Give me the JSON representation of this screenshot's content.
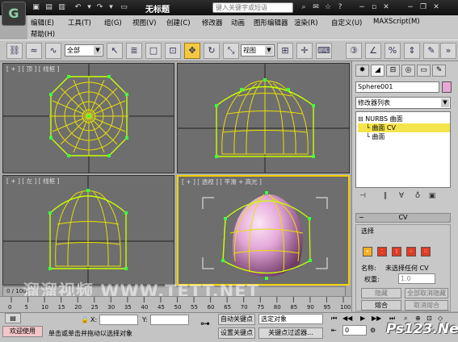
{
  "app": {
    "window_title": "无标题",
    "search_placeholder": "键入关键字或短语",
    "logo_glyph": "G"
  },
  "menu": {
    "items": [
      "编辑(E)",
      "工具(T)",
      "组(G)",
      "视图(V)",
      "创建(C)",
      "修改器",
      "动画",
      "图形编辑器",
      "渲染(R)",
      "自定义(U)",
      "MAXScript(M)",
      "帮助(H)"
    ]
  },
  "toolbar": {
    "filter_value": "全部",
    "coord_value": "视图",
    "active_tool": "select-and-move"
  },
  "viewports": {
    "top": "[ + ] [ 顶 ] [ 线框 ]",
    "left": "[ + ] [ 左 ] [ 线框 ]",
    "persp": "[ + ] [ 透视 ] [ 平滑 + 高光 ]"
  },
  "command_panel": {
    "object_name": "Sphere001",
    "object_color": "#e8a6d4",
    "modifier_list": "修改器列表",
    "stack": [
      "NURBS 曲面",
      "曲面 CV",
      "曲面"
    ],
    "rollout_title": "CV",
    "selection_label": "选择",
    "name_label": "名称:",
    "name_value": "未选择任何 CV",
    "weight_label": "权重:",
    "weight_value": "1.0",
    "hide_button": "隐藏",
    "unhide_all_button": "全部取消隐藏",
    "fuse_button": "熔合",
    "unfuse_button": "取消熔合"
  },
  "timeline": {
    "frame_label": "0 / 100",
    "ticks": [
      "0",
      "5",
      "10",
      "15",
      "20",
      "25",
      "30",
      "35",
      "40",
      "45",
      "50",
      "55",
      "60",
      "65",
      "70",
      "75",
      "80",
      "85",
      "90",
      "95",
      "100"
    ]
  },
  "status": {
    "welcome": "欢迎使用",
    "prompt": "单击或单击并拖动以选择对象",
    "x_label": "X:",
    "y_label": "Y:",
    "auto_key": "自动关键点",
    "set_key": "设置关键点",
    "selected_object": "选定对象",
    "key_filters": "关键点过滤器...",
    "frame_value": "0"
  },
  "watermark": "溜溜视频 WWW.TETT.NET",
  "corner_logo": "Ps123.Net"
}
